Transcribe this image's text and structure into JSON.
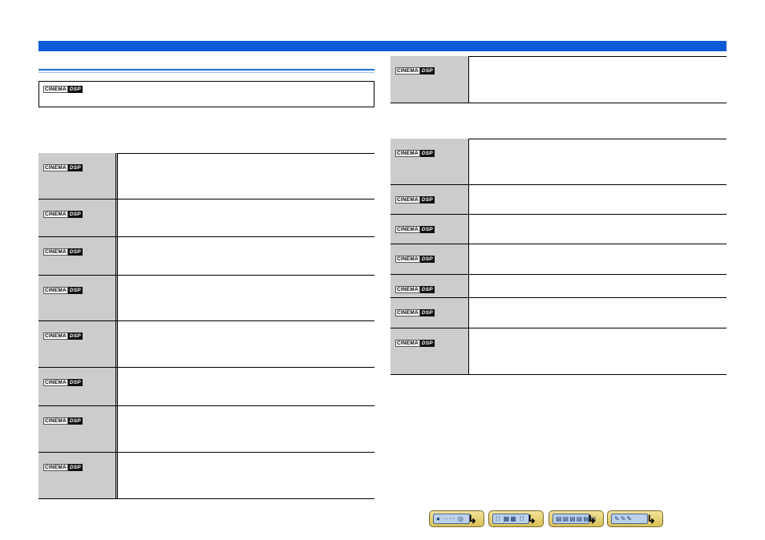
{
  "badge": {
    "cinema": "CINEMA",
    "dsp": "DSP"
  },
  "left_rows": [
    {
      "height": 58
    },
    {
      "height": 47
    },
    {
      "height": 48
    },
    {
      "height": 57
    },
    {
      "height": 58
    },
    {
      "height": 48
    },
    {
      "height": 58
    },
    {
      "height": 58
    }
  ],
  "right_rows_a": [
    {
      "height": 59
    }
  ],
  "right_rows_b": [
    {
      "height": 58
    },
    {
      "height": 37
    },
    {
      "height": 37
    },
    {
      "height": 38
    },
    {
      "height": 29
    },
    {
      "height": 38
    },
    {
      "height": 58
    }
  ],
  "nav_buttons": [
    {
      "name": "nav-front-panel",
      "glyph": "●  ····  ◎",
      "arrow": "↳"
    },
    {
      "name": "nav-remote-control",
      "glyph": "⁞⁞ ▦▦ ⁞⁞",
      "arrow": "↳"
    },
    {
      "name": "nav-display-menu",
      "glyph": "▤▤▤▤▤▤",
      "arrow": "↳"
    },
    {
      "name": "nav-index",
      "glyph": "  ✎✎✎",
      "arrow": "↳"
    }
  ]
}
